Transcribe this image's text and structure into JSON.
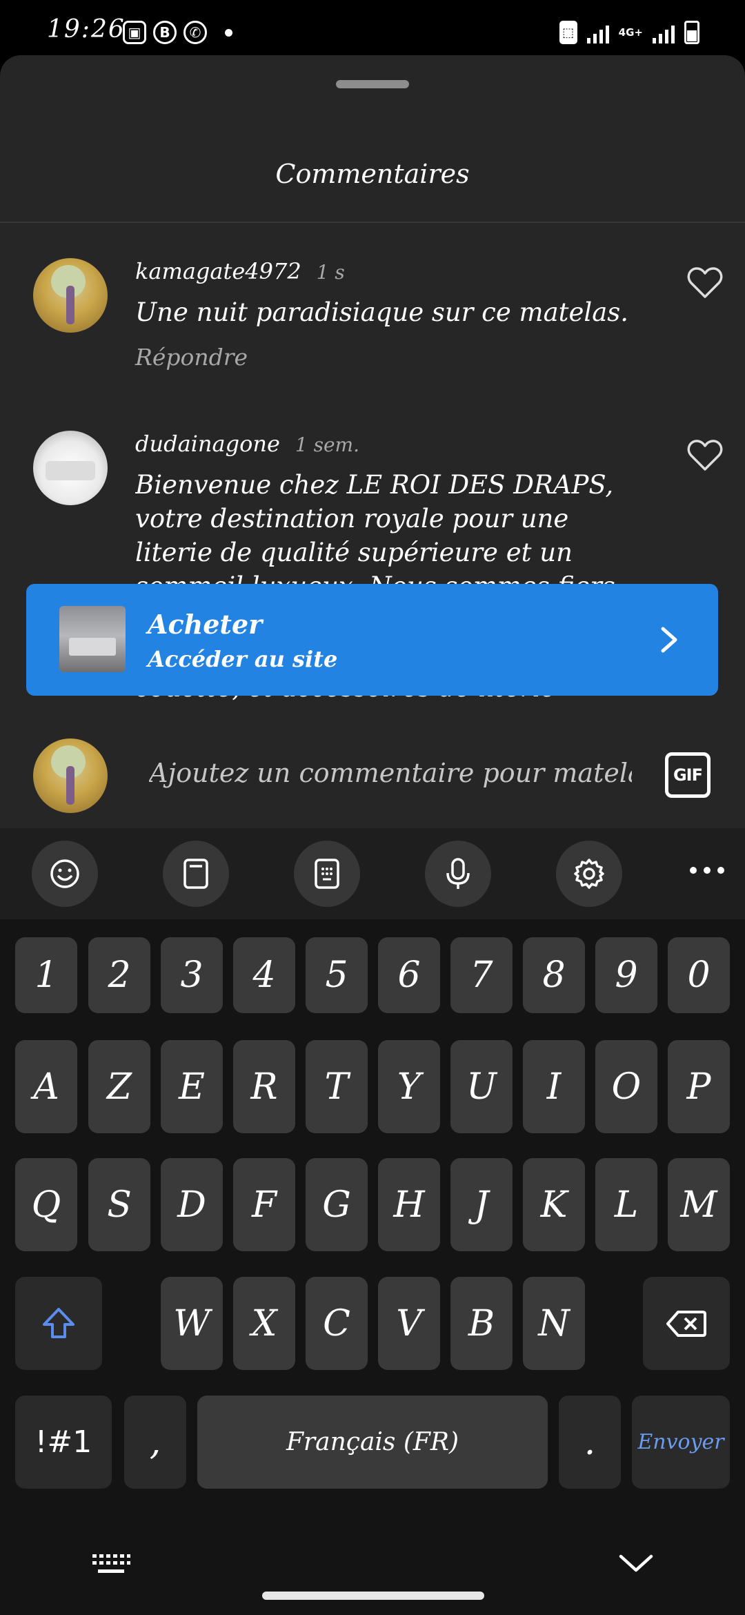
{
  "status_bar": {
    "time": "19:26",
    "network": "4G+",
    "left_icons": [
      "gallery-icon",
      "b-app-icon",
      "whatsapp-icon",
      "dot-icon"
    ],
    "right_icons": [
      "clipboard-icon",
      "signal-icon",
      "signal-icon",
      "battery-icon"
    ]
  },
  "sheet": {
    "title": "Commentaires"
  },
  "comments": [
    {
      "username": "kamagate4972",
      "time": "1 s",
      "text": "Une nuit paradisiaque sur ce matelas.",
      "reply": "Répondre"
    },
    {
      "username": "dudainagone",
      "time": "1 sem.",
      "text": "Bienvenue chez LE ROI DES DRAPS, votre destination royale pour une literie de qualité supérieure et un sommeil luxueux. Nous sommes fiers de vous proposer une large gamme exclusive de draps, housses de couette, et accessoires de literie"
    }
  ],
  "shop_banner": {
    "title": "Acheter",
    "subtitle": "Accéder au site"
  },
  "comment_input": {
    "placeholder": "Ajoutez un commentaire pour matelas",
    "gif_label": "GIF"
  },
  "keyboard": {
    "toolbar": [
      "emoji-icon",
      "clipboard-icon",
      "keypad-icon",
      "microphone-icon",
      "settings-icon",
      "more-icon"
    ],
    "row_numbers": [
      "1",
      "2",
      "3",
      "4",
      "5",
      "6",
      "7",
      "8",
      "9",
      "0"
    ],
    "row_1": [
      "A",
      "Z",
      "E",
      "R",
      "T",
      "Y",
      "U",
      "I",
      "O",
      "P"
    ],
    "row_2": [
      "Q",
      "S",
      "D",
      "F",
      "G",
      "H",
      "J",
      "K",
      "L",
      "M"
    ],
    "row_3": [
      "W",
      "X",
      "C",
      "V",
      "B",
      "N"
    ],
    "symbols_key": "!#1",
    "comma_key": ",",
    "space_key": "Français (FR)",
    "period_key": ".",
    "send_key": "Envoyer"
  },
  "colors": {
    "sheet_bg": "#262626",
    "accent_blue": "#2383e2",
    "send_blue": "#6a9cf0",
    "key_bg": "#3a3a3a"
  }
}
